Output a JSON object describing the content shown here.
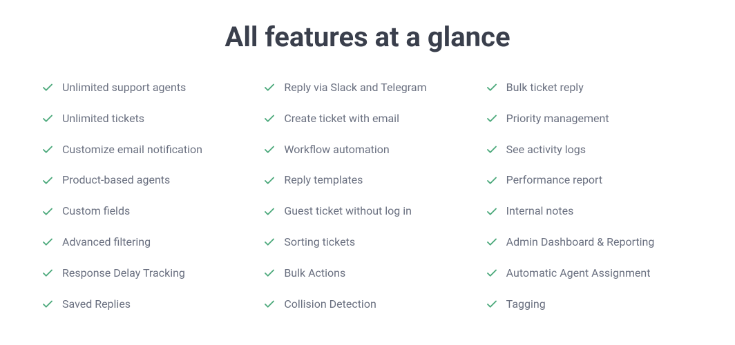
{
  "heading": "All features at a glance",
  "columns": [
    [
      "Unlimited support agents",
      "Unlimited tickets",
      "Customize email notification",
      "Product-based agents",
      "Custom fields",
      "Advanced filtering",
      "Response Delay Tracking",
      "Saved Replies"
    ],
    [
      "Reply via Slack and Telegram",
      "Create ticket with email",
      "Workflow automation",
      "Reply templates",
      "Guest ticket without log in",
      "Sorting tickets",
      "Bulk Actions",
      "Collision Detection"
    ],
    [
      "Bulk ticket reply",
      "Priority management",
      "See activity logs",
      "Performance report",
      "Internal notes",
      "Admin Dashboard & Reporting",
      "Automatic Agent Assignment",
      "Tagging"
    ]
  ]
}
